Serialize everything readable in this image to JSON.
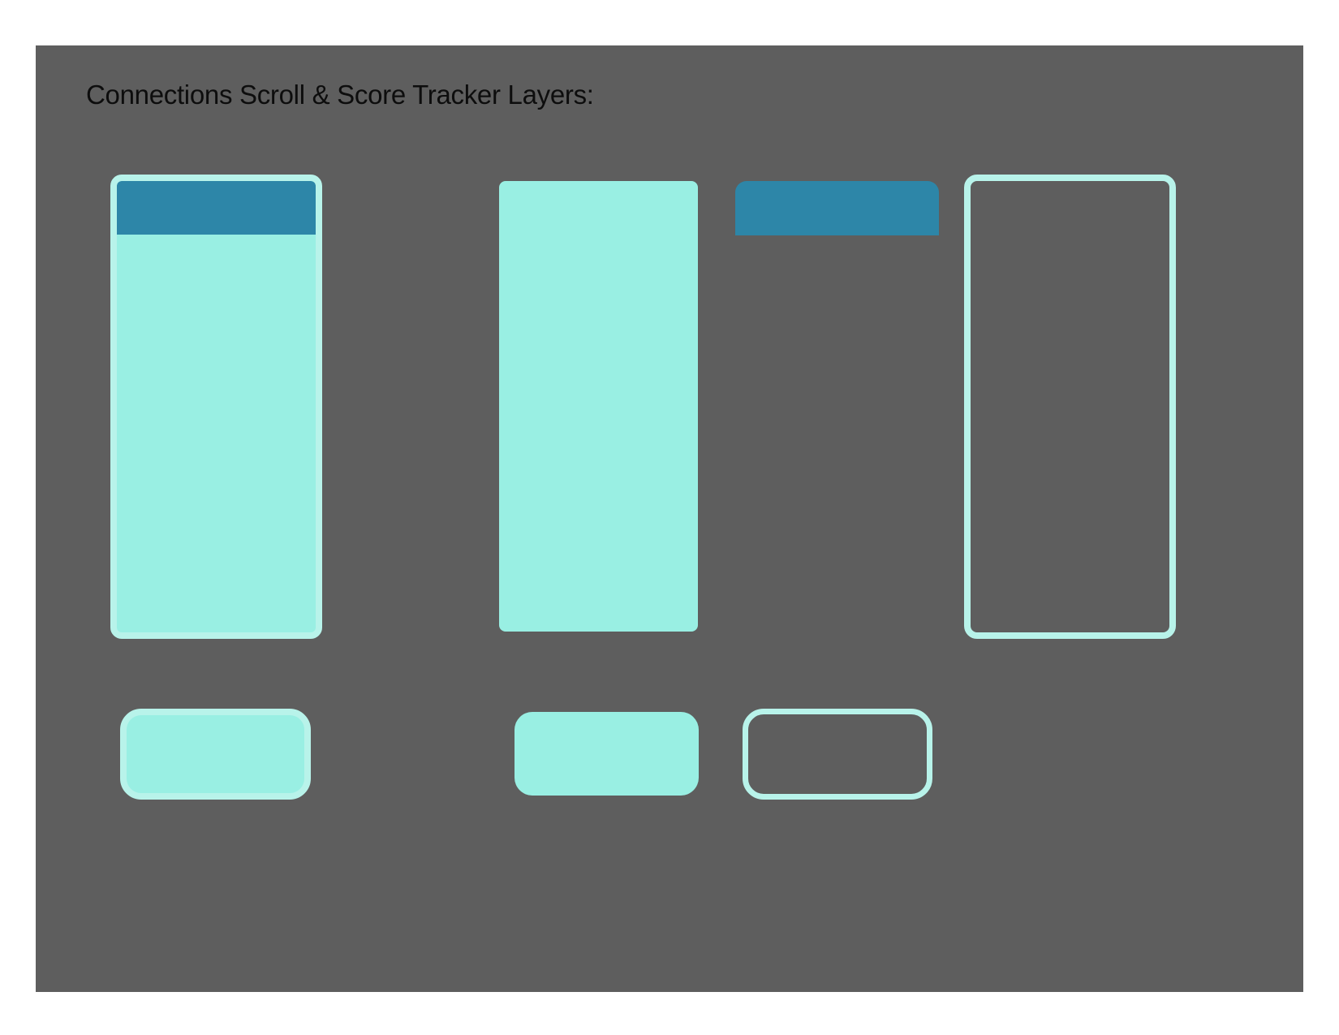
{
  "page": {
    "heading": "Connections Scroll & Score Tracker Layers:"
  },
  "colors": {
    "canvas": "#5e5e5e",
    "fill": "#99efe3",
    "outline": "#b8f3ea",
    "header": "#2d86a8",
    "text": "#0d0d0d"
  },
  "layers": [
    "scroll-composite",
    "scroll-fill",
    "scroll-header",
    "scroll-outline",
    "score-composite",
    "score-fill",
    "score-outline"
  ]
}
